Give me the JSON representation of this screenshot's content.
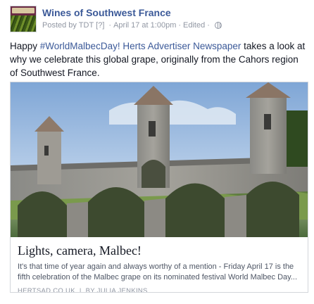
{
  "post": {
    "page_name": "Wines of Southwest France",
    "posted_by": "Posted by TDT",
    "edit_marker": "[?]",
    "date": "April 17 at 1:00pm",
    "edited": "Edited",
    "text_hashtag": "#WorldMalbecDay!",
    "text_prefix": "Happy ",
    "text_mention": "Herts Advertiser Newspaper",
    "text_suffix": " takes a look at why we celebrate this global grape, originally from the Cahors region of Southwest France."
  },
  "link_card": {
    "title": "Lights, camera, Malbec!",
    "description": "It's that time of year again and always worthy of a mention - Friday April 17 is the fifth celebration of the Malbec grape on its nominated festival World Malbec Day...",
    "domain": "HERTSAD.CO.UK",
    "separator": "|",
    "byline": "BY JULIA JENKINS"
  },
  "icons": {
    "avatar": "wine-label-logo",
    "audience": "globe-icon"
  },
  "colors": {
    "link": "#3b5998",
    "meta": "#9197a3",
    "text": "#141823"
  }
}
